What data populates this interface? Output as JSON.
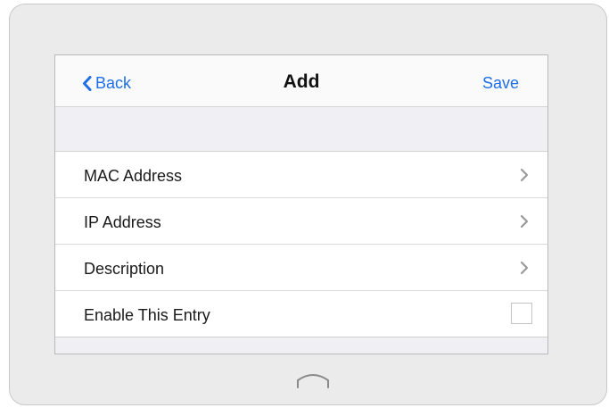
{
  "navbar": {
    "back_label": "Back",
    "title": "Add",
    "save_label": "Save"
  },
  "rows": [
    {
      "label": "MAC Address",
      "control": "chevron-right-icon"
    },
    {
      "label": "IP Address",
      "control": "chevron-right-icon"
    },
    {
      "label": "Description",
      "control": "chevron-right-icon"
    },
    {
      "label": "Enable This Entry",
      "control": "checkbox",
      "checked": false
    }
  ],
  "colors": {
    "accent": "#1e6ee8",
    "device_frame": "#ebebeb",
    "group_background": "#efeff4"
  },
  "icons": {
    "back": "chevron-left-icon",
    "home": "home-button-icon"
  }
}
